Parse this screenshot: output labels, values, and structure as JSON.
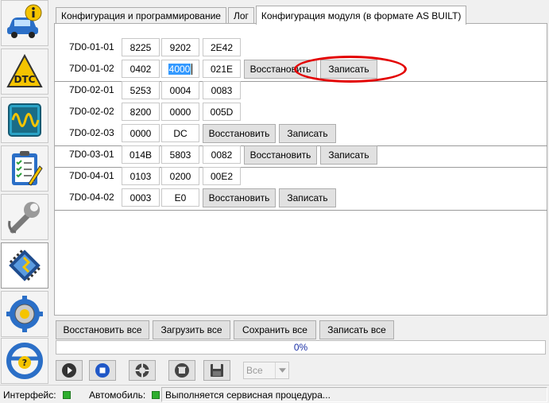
{
  "sidebar": {
    "items": [
      {
        "name": "vehicle-info",
        "icon": "car-info-icon"
      },
      {
        "name": "dtc",
        "icon": "dtc-warning-icon"
      },
      {
        "name": "oscilloscope",
        "icon": "oscilloscope-icon"
      },
      {
        "name": "checklist",
        "icon": "checklist-icon"
      },
      {
        "name": "service",
        "icon": "wrench-icon"
      },
      {
        "name": "module-programming",
        "icon": "chip-icon",
        "active": true
      },
      {
        "name": "settings",
        "icon": "gear-icon"
      },
      {
        "name": "help",
        "icon": "steering-help-icon"
      }
    ]
  },
  "tabs": [
    {
      "label": "Конфигурация и программирование"
    },
    {
      "label": "Лог"
    },
    {
      "label": "Конфигурация модуля (в формате AS BUILT)",
      "active": true
    }
  ],
  "rows": [
    {
      "addr": "7D0-01-01",
      "v1": "8225",
      "v2": "9202",
      "v3": "2E42"
    },
    {
      "addr": "7D0-01-02",
      "v1": "0402",
      "v2": "4000",
      "v3": "021E",
      "restore": "Восстановить",
      "write": "Записать"
    },
    {
      "addr": "7D0-02-01",
      "v1": "5253",
      "v2": "0004",
      "v3": "0083"
    },
    {
      "addr": "7D0-02-02",
      "v1": "8200",
      "v2": "0000",
      "v3": "005D"
    },
    {
      "addr": "7D0-02-03",
      "v1": "0000",
      "v2": "DC",
      "restore": "Восстановить",
      "write": "Записать"
    },
    {
      "addr": "7D0-03-01",
      "v1": "014B",
      "v2": "5803",
      "v3": "0082",
      "restore": "Восстановить",
      "write": "Записать"
    },
    {
      "addr": "7D0-04-01",
      "v1": "0103",
      "v2": "0200",
      "v3": "00E2"
    },
    {
      "addr": "7D0-04-02",
      "v1": "0003",
      "v2": "E0",
      "restore": "Восстановить",
      "write": "Записать"
    }
  ],
  "actions": {
    "restore_all": "Восстановить все",
    "load_all": "Загрузить все",
    "save_all": "Сохранить все",
    "write_all": "Записать все"
  },
  "progress": {
    "value": 0,
    "label": "0%"
  },
  "toolbar": {
    "icons": [
      "play-icon",
      "stop-icon",
      "lifebuoy-icon",
      "erase-icon",
      "save-icon"
    ],
    "filter_value": "Все"
  },
  "status": {
    "interface_label": "Интерфейс:",
    "vehicle_label": "Автомобиль:",
    "message": "Выполняется сервисная процедура..."
  },
  "colors": {
    "accent": "#3399ff",
    "highlight": "#e30000",
    "led": "#2fae2f",
    "progress_text": "#1a2fa5"
  }
}
